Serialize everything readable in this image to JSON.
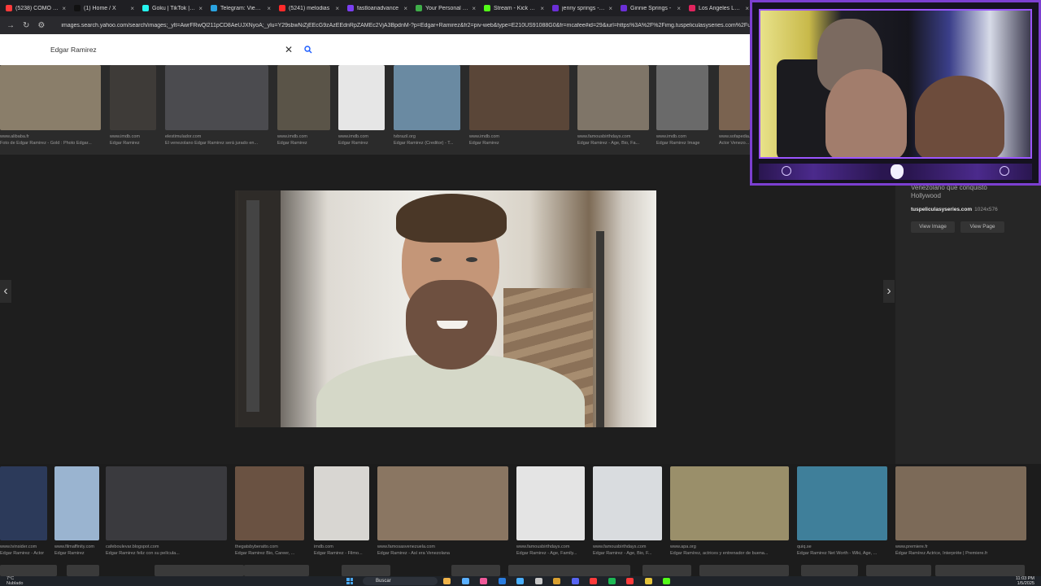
{
  "browser": {
    "tabs": [
      {
        "label": "(5238) COMO HA",
        "color": "#ff3b3b"
      },
      {
        "label": "(1) Home / X",
        "color": "#111111"
      },
      {
        "label": "Goku | TikTok | Li",
        "color": "#25f4ee"
      },
      {
        "label": "Telegram: View @",
        "color": "#2aa3e0"
      },
      {
        "label": "(5241) melodias",
        "color": "#ff2a2a"
      },
      {
        "label": "fastloanadvance",
        "color": "#7b3ff2"
      },
      {
        "label": "Your Personal Loa",
        "color": "#3fae49"
      },
      {
        "label": "Stream - Kick Das",
        "color": "#53fc18"
      },
      {
        "label": "jenny springs - Ya",
        "color": "#6b2fd6"
      },
      {
        "label": "Ginnie Springs -",
        "color": "#6b2fd6"
      },
      {
        "label": "Los Angeles Lake",
        "color": "#e0245e"
      }
    ],
    "url": "images.search.yahoo.com/search/images;_ylt=AwrFRwQl211pCD8AeUJXNyoA;_ylu=Y29sbwNiZjEEcG9zAzEEdnRpZAMEc2VjA3BpdnM-?p=Edgar+Ramirez&fr2=piv-web&type=E210US91088G0&fr=mcafee#id=29&iurl=https%3A%2F%2Fimg.tuspeliculasyseries.com%2Fupload"
  },
  "search": {
    "query": "Edgar Ramirez"
  },
  "top_results": [
    {
      "caption": "www.alibaba.fr\nFoto de Edgar Ramirez - Gold : Photo Edgar...",
      "color": "#8a7e6a"
    },
    {
      "caption": "www.imdb.com\nEdgar Ramirez",
      "color": "#3e3b38"
    },
    {
      "caption": "elestimulador.com\nEl venezolano Edgar Ramirez será jurado en...",
      "color": "#4b4b4f"
    },
    {
      "caption": "www.imdb.com\nEdgar Ramirez",
      "color": "#5a5448"
    },
    {
      "caption": "www.imdb.com\nEdgar Ramirez",
      "color": "#e6e6e6"
    },
    {
      "caption": "tvbrazil.org\nEdgar Ramirez (Creditor) - T...",
      "color": "#6a8aa2"
    },
    {
      "caption": "www.imdb.com\nEdgar Ramirez",
      "color": "#5a4638"
    },
    {
      "caption": "www.famousbirthdays.com\nEdgar Ramirez - Age, Bio, Fa...",
      "color": "#7f7568"
    },
    {
      "caption": "www.imdb.com\nEdgar Ramirez Image",
      "color": "#6a6a6a"
    },
    {
      "caption": "www.sofapedia.com\nActor Venezo...",
      "color": "#7a6350"
    }
  ],
  "viewer": {
    "prev_label": "‹",
    "next_label": "›",
    "image_alt": "Edgar Ramirez"
  },
  "info_panel": {
    "description": "Venezolano que conquistó Hollywood",
    "source": "tuspeliculasyseries.com",
    "dimensions": "1024x576",
    "view_image": "View Image",
    "view_page": "View Page"
  },
  "bottom_results": [
    {
      "caption": "www.tvinsider.com\nEdgar Ramirez - Actor",
      "color": "#2c3a5a"
    },
    {
      "caption": "www.filmaffinity.com\nEdgar Ramirez",
      "color": "#9ab4d0"
    },
    {
      "caption": "cafeboulevar.blogspot.com\nEdgar Ramirez feliz con su película...",
      "color": "#3a3a3e"
    },
    {
      "caption": "thegatsbyberatto.com\nEdgar Ramirez Bio, Career, ...",
      "color": "#6a5242"
    },
    {
      "caption": "imdb.com\nEdgar Ramirez - Filmo...",
      "color": "#d8d6d2"
    },
    {
      "caption": "www.famosasvenezuela.com\nEdgar Ramirez - Así era Venezolana",
      "color": "#8a7662"
    },
    {
      "caption": "www.famousbirthdays.com\nEdgar Ramirez - Age, Family...",
      "color": "#e4e4e4"
    },
    {
      "caption": "www.famousbirthdays.com\nEdgar Ramirez - Age, Bio, F...",
      "color": "#d9dcdf"
    },
    {
      "caption": "www.apa.org\nEdgar Ramírez, actrices y entrenador de buena...",
      "color": "#9a8f6a"
    },
    {
      "caption": "quiq.se\nEdgar Ramirez Net Worth - Wiki, Age, ...",
      "color": "#3f7f9a"
    },
    {
      "caption": "www.premiere.fr\nÉdgar Ramírez Actrice, Interprète | Premiere.fr",
      "color": "#7c6a58"
    }
  ],
  "taskbar": {
    "weather_temp": "7°C",
    "weather_desc": "Nublado",
    "search_label": "Buscar",
    "time": "11:03 PM",
    "date": "1/5/2025",
    "apps": [
      "#f0b44a",
      "#5ab0ff",
      "#f05a9a",
      "#2a7de0",
      "#4ab0ff",
      "#c8c8c8",
      "#d9a030",
      "#5865f2",
      "#ff3b3b",
      "#1db954",
      "#ff3b3b",
      "#e5c43c",
      "#53fc18"
    ]
  },
  "webcam": {
    "frame_color": "#7c3fd1"
  }
}
